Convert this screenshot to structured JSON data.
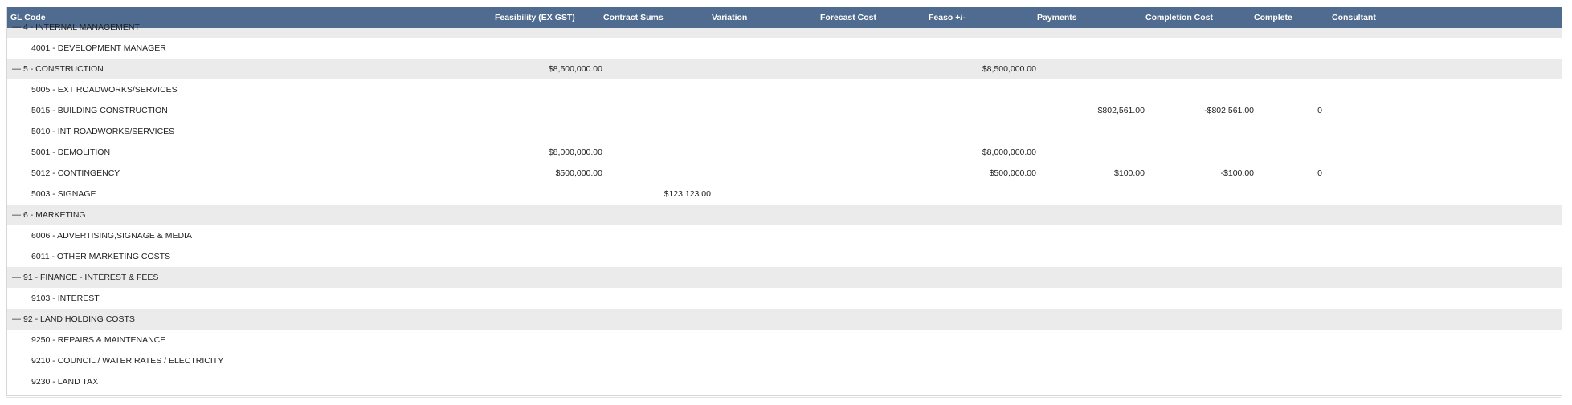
{
  "columns": [
    "GL Code",
    "Feasibility (EX GST)",
    "Contract Sums",
    "Variation",
    "Forecast Cost",
    "Feaso +/-",
    "Payments",
    "Completion Cost",
    "Complete",
    "Consultant"
  ],
  "toggle_glyph": "—",
  "rows": [
    {
      "type": "group",
      "label": "4 - INTERNAL MANAGEMENT"
    },
    {
      "type": "child",
      "label": "4001 - DEVELOPMENT MANAGER"
    },
    {
      "type": "group",
      "label": "5 - CONSTRUCTION",
      "feasibility": "$8,500,000.00",
      "feaso": "$8,500,000.00"
    },
    {
      "type": "child",
      "label": "5005 - EXT ROADWORKS/SERVICES"
    },
    {
      "type": "child",
      "label": "5015 - BUILDING CONSTRUCTION",
      "payments": "$802,561.00",
      "completion": "-$802,561.00",
      "complete": "0"
    },
    {
      "type": "child",
      "label": "5010 - INT ROADWORKS/SERVICES"
    },
    {
      "type": "child",
      "label": "5001 - DEMOLITION",
      "feasibility": "$8,000,000.00",
      "feaso": "$8,000,000.00"
    },
    {
      "type": "child",
      "label": "5012 - CONTINGENCY",
      "feasibility": "$500,000.00",
      "feaso": "$500,000.00",
      "payments": "$100.00",
      "completion": "-$100.00",
      "complete": "0"
    },
    {
      "type": "child",
      "label": "5003 - SIGNAGE",
      "contract": "$123,123.00"
    },
    {
      "type": "group",
      "label": "6 - MARKETING"
    },
    {
      "type": "child",
      "label": "6006 - ADVERTISING,SIGNAGE & MEDIA"
    },
    {
      "type": "child",
      "label": "6011 - OTHER MARKETING COSTS"
    },
    {
      "type": "group",
      "label": "91 - FINANCE - INTEREST & FEES"
    },
    {
      "type": "child",
      "label": "9103 - INTEREST"
    },
    {
      "type": "group",
      "label": "92 - LAND HOLDING COSTS"
    },
    {
      "type": "child",
      "label": "9250 - REPAIRS & MAINTENANCE"
    },
    {
      "type": "child",
      "label": "9210 - COUNCIL / WATER RATES / ELECTRICITY"
    },
    {
      "type": "child",
      "label": "9230 - LAND TAX"
    }
  ],
  "colors": {
    "header_bg": "#4f6b8f",
    "group_row_bg": "#ebebeb"
  }
}
